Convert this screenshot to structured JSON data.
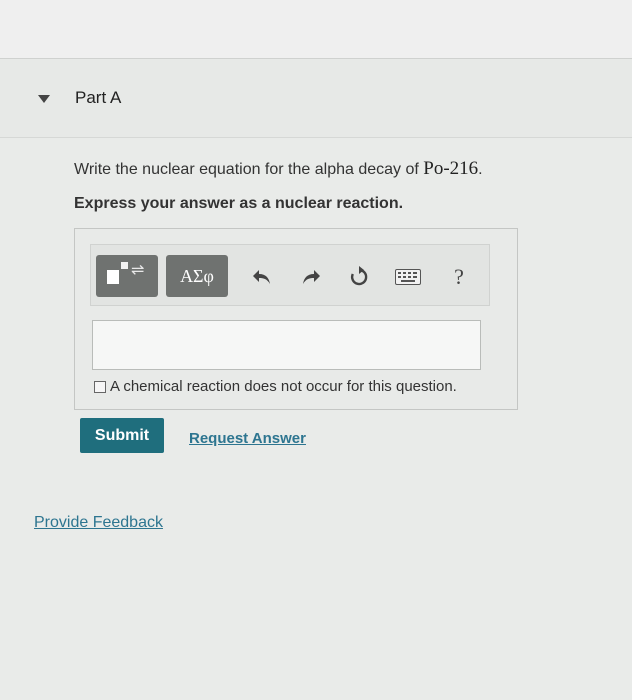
{
  "part": {
    "title": "Part A"
  },
  "question": {
    "text": "Write the nuclear equation for the alpha decay of ",
    "isotope": "Po-216",
    "end": ".",
    "instruction": "Express your answer as a nuclear reaction."
  },
  "toolbar": {
    "templates_icon": "templates-icon",
    "greek_label": "ΑΣφ",
    "undo_icon": "undo-icon",
    "redo_icon": "redo-icon",
    "reset_icon": "reset-icon",
    "keyboard_icon": "keyboard-icon",
    "help_label": "?"
  },
  "answer": {
    "value": "",
    "no_reaction_label": "A chemical reaction does not occur for this question."
  },
  "actions": {
    "submit_label": "Submit",
    "request_answer_label": "Request Answer"
  },
  "footer": {
    "feedback_label": "Provide Feedback"
  },
  "colors": {
    "submit_bg": "#1f6e7d",
    "link": "#2d7590",
    "tool_button": "#6f7270"
  }
}
